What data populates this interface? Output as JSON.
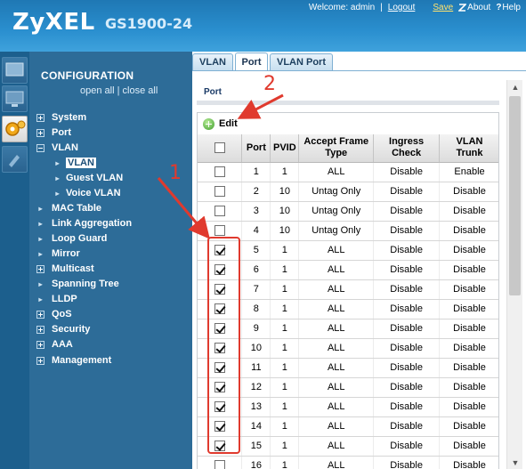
{
  "header": {
    "brand": "ZyXEL",
    "model": "GS1900-24",
    "welcome": "Welcome: admin",
    "logout": "Logout",
    "save": "Save",
    "about": "About",
    "help": "Help"
  },
  "sidebar": {
    "title": "CONFIGURATION",
    "open_all": "open all",
    "close_all": "close all",
    "items": [
      {
        "label": "System",
        "type": "plus"
      },
      {
        "label": "Port",
        "type": "plus"
      },
      {
        "label": "VLAN",
        "type": "minus"
      },
      {
        "label": "MAC Table",
        "type": "dot"
      },
      {
        "label": "Link Aggregation",
        "type": "dot"
      },
      {
        "label": "Loop Guard",
        "type": "dot"
      },
      {
        "label": "Mirror",
        "type": "dot"
      },
      {
        "label": "Multicast",
        "type": "plus"
      },
      {
        "label": "Spanning Tree",
        "type": "dot"
      },
      {
        "label": "LLDP",
        "type": "dot"
      },
      {
        "label": "QoS",
        "type": "plus"
      },
      {
        "label": "Security",
        "type": "plus"
      },
      {
        "label": "AAA",
        "type": "plus"
      },
      {
        "label": "Management",
        "type": "plus"
      }
    ],
    "vlan_sub": [
      "VLAN",
      "Guest VLAN",
      "Voice VLAN"
    ]
  },
  "tabs": [
    "VLAN",
    "Port",
    "VLAN Port"
  ],
  "content": {
    "section_title": "Port",
    "edit_label": "Edit"
  },
  "table": {
    "headers": {
      "port": "Port",
      "pvid": "PVID",
      "accept_line1": "Accept Frame",
      "accept_line2": "Type",
      "ingress_line1": "Ingress",
      "ingress_line2": "Check",
      "trunk_line1": "VLAN",
      "trunk_line2": "Trunk"
    },
    "rows": [
      {
        "checked": false,
        "port": "1",
        "pvid": "1",
        "accept": "ALL",
        "ingress": "Disable",
        "trunk": "Enable"
      },
      {
        "checked": false,
        "port": "2",
        "pvid": "10",
        "accept": "Untag Only",
        "ingress": "Disable",
        "trunk": "Disable"
      },
      {
        "checked": false,
        "port": "3",
        "pvid": "10",
        "accept": "Untag Only",
        "ingress": "Disable",
        "trunk": "Disable"
      },
      {
        "checked": false,
        "port": "4",
        "pvid": "10",
        "accept": "Untag Only",
        "ingress": "Disable",
        "trunk": "Disable"
      },
      {
        "checked": true,
        "port": "5",
        "pvid": "1",
        "accept": "ALL",
        "ingress": "Disable",
        "trunk": "Disable"
      },
      {
        "checked": true,
        "port": "6",
        "pvid": "1",
        "accept": "ALL",
        "ingress": "Disable",
        "trunk": "Disable"
      },
      {
        "checked": true,
        "port": "7",
        "pvid": "1",
        "accept": "ALL",
        "ingress": "Disable",
        "trunk": "Disable"
      },
      {
        "checked": true,
        "port": "8",
        "pvid": "1",
        "accept": "ALL",
        "ingress": "Disable",
        "trunk": "Disable"
      },
      {
        "checked": true,
        "port": "9",
        "pvid": "1",
        "accept": "ALL",
        "ingress": "Disable",
        "trunk": "Disable"
      },
      {
        "checked": true,
        "port": "10",
        "pvid": "1",
        "accept": "ALL",
        "ingress": "Disable",
        "trunk": "Disable"
      },
      {
        "checked": true,
        "port": "11",
        "pvid": "1",
        "accept": "ALL",
        "ingress": "Disable",
        "trunk": "Disable"
      },
      {
        "checked": true,
        "port": "12",
        "pvid": "1",
        "accept": "ALL",
        "ingress": "Disable",
        "trunk": "Disable"
      },
      {
        "checked": true,
        "port": "13",
        "pvid": "1",
        "accept": "ALL",
        "ingress": "Disable",
        "trunk": "Disable"
      },
      {
        "checked": true,
        "port": "14",
        "pvid": "1",
        "accept": "ALL",
        "ingress": "Disable",
        "trunk": "Disable"
      },
      {
        "checked": true,
        "port": "15",
        "pvid": "1",
        "accept": "ALL",
        "ingress": "Disable",
        "trunk": "Disable"
      },
      {
        "checked": false,
        "port": "16",
        "pvid": "1",
        "accept": "ALL",
        "ingress": "Disable",
        "trunk": "Disable"
      }
    ]
  },
  "annotations": {
    "one": "1",
    "two": "2",
    "color": "#e03a2e"
  },
  "colors": {
    "header": "#2a8fcf",
    "sidebar": "#2d6c98",
    "tab_border": "#7fb0d3"
  }
}
